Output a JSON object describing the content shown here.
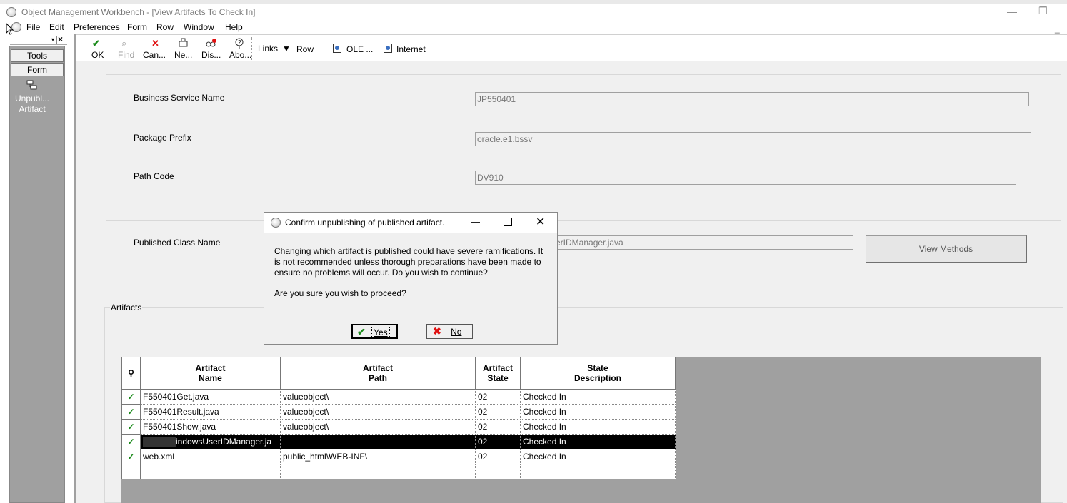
{
  "window": {
    "title": "Object Management Workbench - [View Artifacts To Check In]"
  },
  "menu": [
    "File",
    "Edit",
    "Preferences",
    "Form",
    "Row",
    "Window",
    "Help"
  ],
  "left_panel": {
    "tools_label": "Tools",
    "form_label": "Form",
    "item_line1": "Unpubl...",
    "item_line2": "Artifact"
  },
  "toolbar": {
    "ok": "OK",
    "find": "Find",
    "cancel": "Can...",
    "new": "Ne...",
    "display": "Dis...",
    "about": "Abo...",
    "links": "Links",
    "row": "Row",
    "ole": "OLE ...",
    "internet": "Internet"
  },
  "form": {
    "business_service_name_label": "Business Service Name",
    "business_service_name_value": "JP550401",
    "package_prefix_label": "Package Prefix",
    "package_prefix_value": "oracle.e1.bssv",
    "path_code_label": "Path Code",
    "path_code_value": "DV910",
    "published_class_name_label": "Published Class Name",
    "published_class_name_value": "erIDManager.java",
    "view_methods": "View Methods",
    "artifacts_label": "Artifacts"
  },
  "grid": {
    "headers": [
      {
        "l1": "Artifact",
        "l2": "Name"
      },
      {
        "l1": "Artifact",
        "l2": "Path"
      },
      {
        "l1": "Artifact",
        "l2": "State"
      },
      {
        "l1": "State",
        "l2": "Description"
      }
    ],
    "rows": [
      {
        "name": "F550401Get.java",
        "path": "valueobject\\",
        "state": "02",
        "desc": "Checked In"
      },
      {
        "name": "F550401Result.java",
        "path": "valueobject\\",
        "state": "02",
        "desc": "Checked In"
      },
      {
        "name": "F550401Show.java",
        "path": "valueobject\\",
        "state": "02",
        "desc": "Checked In"
      },
      {
        "name": "indowsUserIDManager.ja",
        "path": "",
        "state": "02",
        "desc": "Checked In"
      },
      {
        "name": "web.xml",
        "path": "public_html\\WEB-INF\\",
        "state": "02",
        "desc": "Checked In"
      }
    ]
  },
  "dialog": {
    "title": "Confirm unpublishing of published artifact.",
    "message": "Changing which artifact is published could have severe ramifications. It is not recommended unless thorough preparations have been made to ensure no problems will occur. Do you wish to continue?",
    "question": "Are you sure you wish to proceed?",
    "yes": "Yes",
    "no": "No"
  },
  "colors": {
    "check": "#1a8a1a",
    "cancel": "#e01010"
  }
}
